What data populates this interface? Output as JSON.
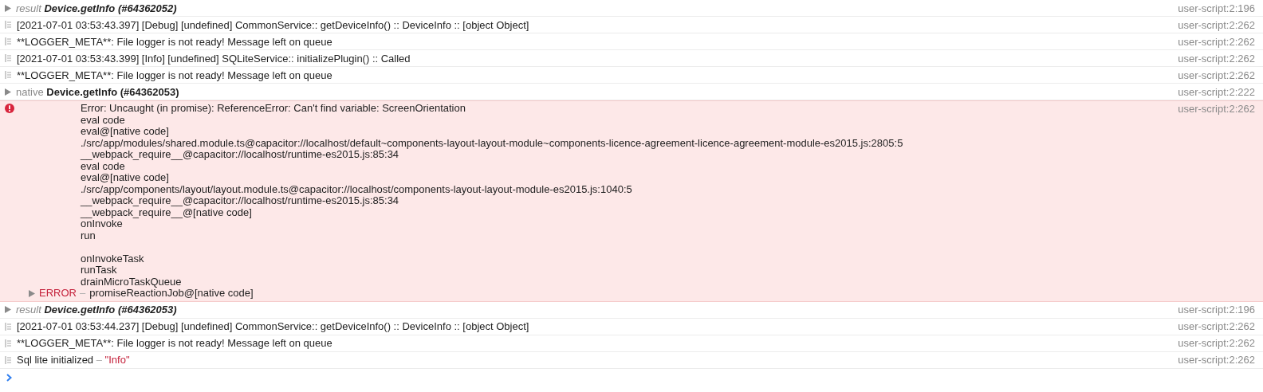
{
  "entries": [
    {
      "kind": "result",
      "prefix": "result",
      "name": "Device.getInfo (#64362052)",
      "source": "user-script:2:196"
    },
    {
      "kind": "log",
      "text": "[2021-07-01 03:53:43.397] [Debug] [undefined] CommonService:: getDeviceInfo() :: DeviceInfo :: [object Object]",
      "source": "user-script:2:262"
    },
    {
      "kind": "log",
      "text": "**LOGGER_META**: File logger is not ready! Message left on queue",
      "source": "user-script:2:262"
    },
    {
      "kind": "log",
      "text": "[2021-07-01 03:53:43.399] [Info] [undefined] SQLiteService:: initializePlugin() :: Called",
      "source": "user-script:2:262"
    },
    {
      "kind": "log",
      "text": "**LOGGER_META**: File logger is not ready! Message left on queue",
      "source": "user-script:2:262"
    },
    {
      "kind": "native",
      "prefix": "native",
      "name": "Device.getInfo (#64362053)",
      "source": "user-script:2:222"
    },
    {
      "kind": "error",
      "message": "Error: Uncaught (in promise): ReferenceError: Can't find variable: ScreenOrientation",
      "source": "user-script:2:262",
      "stack_groups": [
        [
          "eval code",
          "eval@[native code]",
          "./src/app/modules/shared.module.ts@capacitor://localhost/default~components-layout-layout-module~components-licence-agreement-licence-agreement-module-es2015.js:2805:5",
          "__webpack_require__@capacitor://localhost/runtime-es2015.js:85:34",
          "eval code",
          "eval@[native code]",
          "./src/app/components/layout/layout.module.ts@capacitor://localhost/components-layout-layout-module-es2015.js:1040:5",
          "__webpack_require__@capacitor://localhost/runtime-es2015.js:85:34",
          "__webpack_require__@[native code]",
          "onInvoke",
          "run"
        ],
        [
          "onInvokeTask",
          "runTask",
          "drainMicroTaskQueue"
        ]
      ],
      "label": "ERROR",
      "separator": "–",
      "last_frame": "promiseReactionJob@[native code]"
    },
    {
      "kind": "result",
      "prefix": "result",
      "name": "Device.getInfo (#64362053)",
      "source": "user-script:2:196"
    },
    {
      "kind": "log",
      "text": "[2021-07-01 03:53:44.237] [Debug] [undefined] CommonService:: getDeviceInfo() :: DeviceInfo :: [object Object]",
      "source": "user-script:2:262"
    },
    {
      "kind": "log",
      "text": "**LOGGER_META**: File logger is not ready! Message left on queue",
      "source": "user-script:2:262"
    },
    {
      "kind": "log",
      "text": "Sql lite initialized",
      "separator": "–",
      "value": "\"Info\"",
      "source": "user-script:2:262"
    }
  ]
}
